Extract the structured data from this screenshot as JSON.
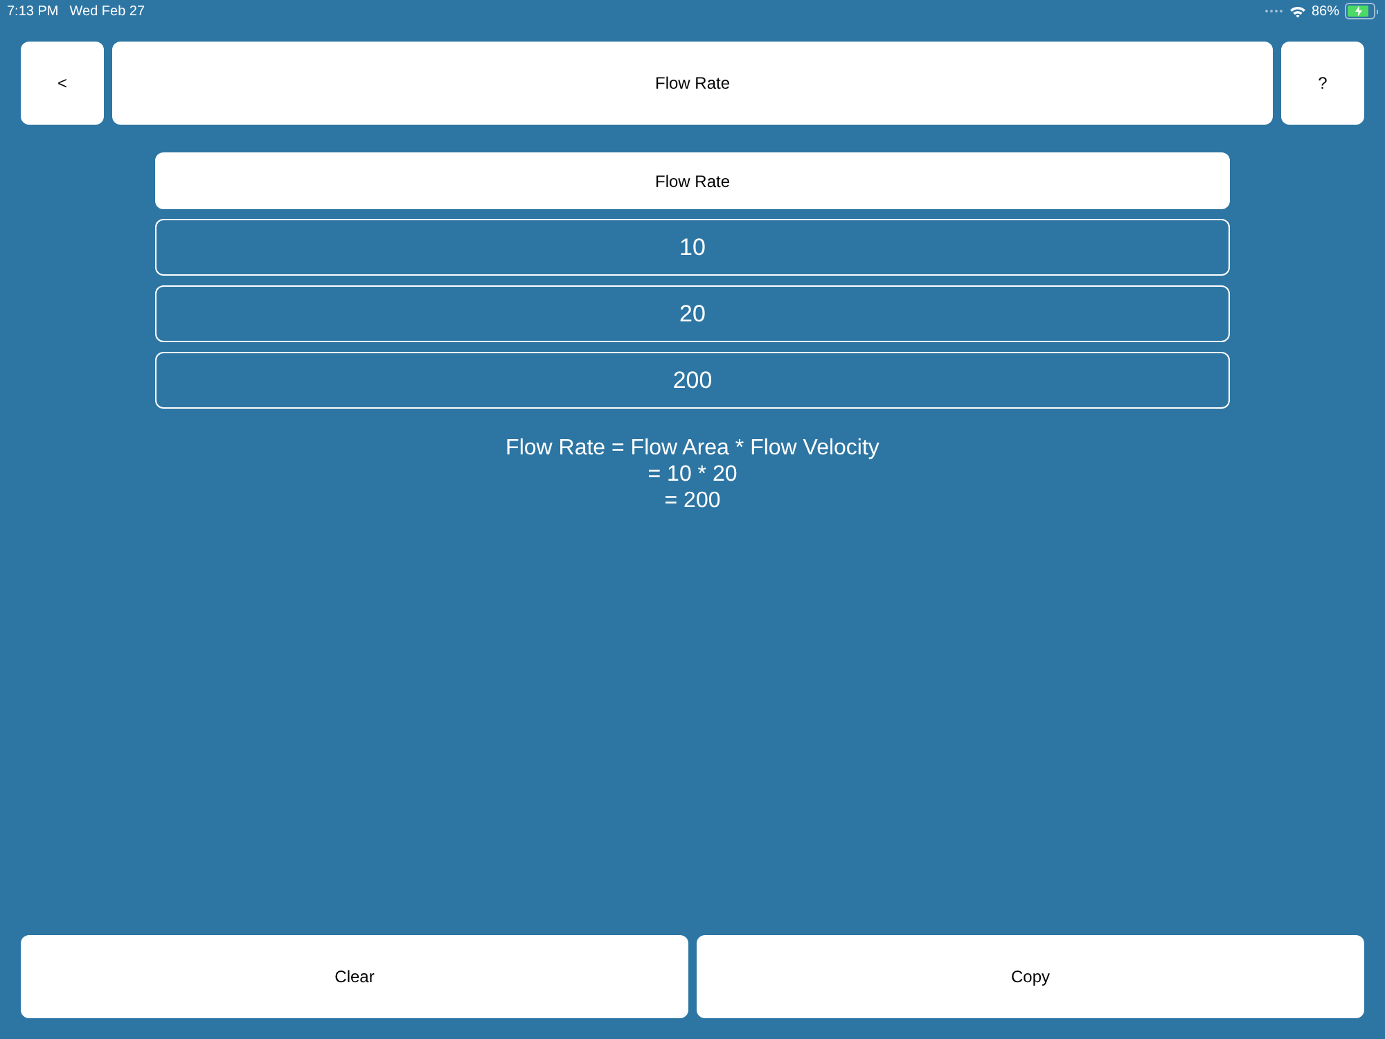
{
  "status_bar": {
    "time": "7:13 PM",
    "date": "Wed Feb 27",
    "battery": "86%",
    "charging": true
  },
  "header": {
    "back": "<",
    "title": "Flow Rate",
    "help": "?"
  },
  "calculator": {
    "heading": "Flow Rate",
    "fields": [
      {
        "value": "10"
      },
      {
        "value": "20"
      },
      {
        "value": "200"
      }
    ],
    "result": [
      "Flow Rate = Flow Area * Flow Velocity",
      "= 10 * 20",
      "= 200"
    ]
  },
  "buttons": [
    "Clear",
    "Copy"
  ]
}
